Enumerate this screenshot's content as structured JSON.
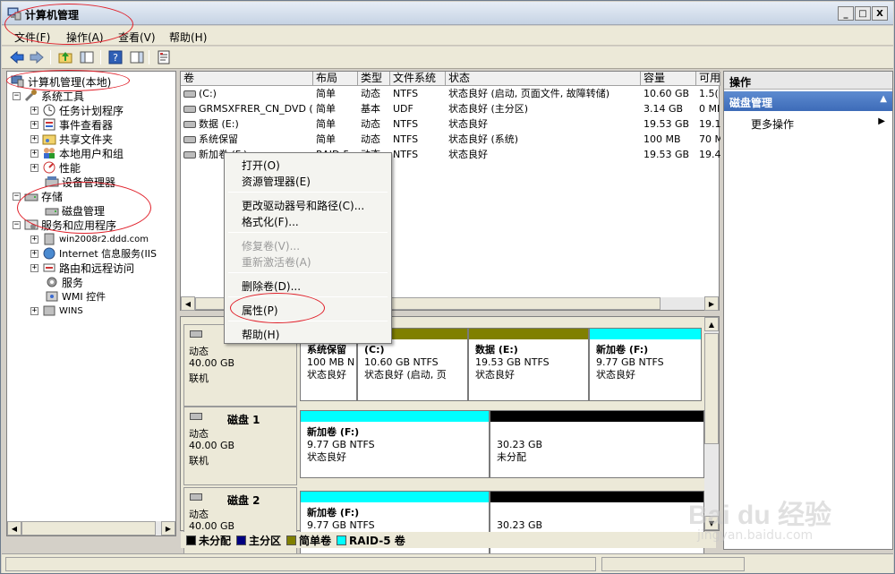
{
  "window": {
    "title": "计算机管理",
    "controls": [
      "_",
      "□",
      "X"
    ]
  },
  "menu": [
    "文件(F)",
    "操作(A)",
    "查看(V)",
    "帮助(H)"
  ],
  "tree": {
    "root": "计算机管理(本地)",
    "system_tools": "系统工具",
    "system_items": [
      "任务计划程序",
      "事件查看器",
      "共享文件夹",
      "本地用户和组",
      "性能",
      "设备管理器"
    ],
    "storage": "存储",
    "disk_mgmt": "磁盘管理",
    "services_apps": "服务和应用程序",
    "services_items": [
      "win2008r2.ddd.com",
      "Internet 信息服务(IIS",
      "路由和远程访问",
      "服务",
      "WMI 控件",
      "WINS"
    ]
  },
  "volume_table": {
    "headers": [
      "卷",
      "布局",
      "类型",
      "文件系统",
      "状态",
      "容量",
      "可用"
    ],
    "rows": [
      [
        "(C:)",
        "简单",
        "动态",
        "NTFS",
        "状态良好 (启动, 页面文件, 故障转储)",
        "10.60 GB",
        "1.5("
      ],
      [
        "GRMSXFRER_CN_DVD (D:)",
        "简单",
        "基本",
        "UDF",
        "状态良好 (主分区)",
        "3.14 GB",
        "0 MI"
      ],
      [
        "数据 (E:)",
        "简单",
        "动态",
        "NTFS",
        "状态良好",
        "19.53 GB",
        "19.1"
      ],
      [
        "系统保留",
        "简单",
        "动态",
        "NTFS",
        "状态良好 (系统)",
        "100 MB",
        "70 M"
      ],
      [
        "新加卷 (F:)",
        "RAID-5",
        "动态",
        "NTFS",
        "状态良好",
        "19.53 GB",
        "19.4"
      ]
    ]
  },
  "context_menu": {
    "items": [
      {
        "label": "打开(O)",
        "enabled": true
      },
      {
        "label": "资源管理器(E)",
        "enabled": true
      },
      {
        "label": "更改驱动器号和路径(C)...",
        "enabled": true
      },
      {
        "label": "格式化(F)...",
        "enabled": true
      },
      {
        "label": "修复卷(V)...",
        "enabled": false
      },
      {
        "label": "重新激活卷(A)",
        "enabled": false
      },
      {
        "label": "删除卷(D)...",
        "enabled": true
      },
      {
        "label": "属性(P)",
        "enabled": true
      },
      {
        "label": "帮助(H)",
        "enabled": true
      }
    ]
  },
  "disks": [
    {
      "name": "",
      "type": "动态",
      "size": "40.00 GB",
      "status": "联机",
      "partitions": [
        {
          "name": "系统保留",
          "size": "100 MB N",
          "status": "状态良好",
          "color": "#000080"
        },
        {
          "name": "(C:)",
          "size": "10.60 GB NTFS",
          "status": "状态良好 (启动, 页",
          "color": "#808000"
        },
        {
          "name": "数据  (E:)",
          "size": "19.53 GB NTFS",
          "status": "状态良好",
          "color": "#808000"
        },
        {
          "name": "新加卷  (F:)",
          "size": "9.77 GB NTFS",
          "status": "状态良好",
          "color": "#00ffff"
        }
      ]
    },
    {
      "name": "磁盘 1",
      "type": "动态",
      "size": "40.00 GB",
      "status": "联机",
      "partitions": [
        {
          "name": "新加卷  (F:)",
          "size": "9.77 GB NTFS",
          "status": "状态良好",
          "color": "#00ffff"
        },
        {
          "name": "",
          "size": "30.23 GB",
          "status": "未分配",
          "color": "#000000"
        }
      ]
    },
    {
      "name": "磁盘 2",
      "type": "动态",
      "size": "40.00 GB",
      "status": "",
      "partitions": [
        {
          "name": "新加卷  (F:)",
          "size": "9.77 GB NTFS",
          "status": "",
          "color": "#00ffff"
        },
        {
          "name": "",
          "size": "30.23 GB",
          "status": "",
          "color": "#000000"
        }
      ]
    }
  ],
  "legend": [
    {
      "label": "未分配",
      "color": "#000000"
    },
    {
      "label": "主分区",
      "color": "#000080"
    },
    {
      "label": "简单卷",
      "color": "#808000"
    },
    {
      "label": "RAID-5 卷",
      "color": "#00ffff"
    }
  ],
  "actions": {
    "header": "操作",
    "section": "磁盘管理",
    "more": "更多操作"
  },
  "watermark": {
    "brand": "Bai du 经验",
    "url": "jingyan.baidu.com"
  }
}
